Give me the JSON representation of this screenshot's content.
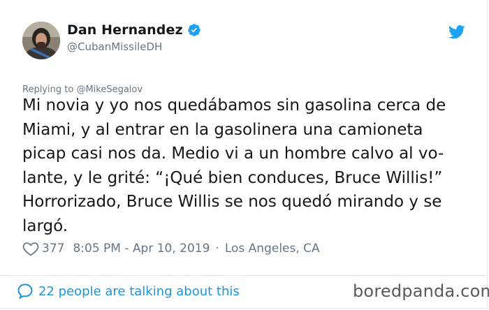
{
  "author": {
    "name": "Dan Hernandez",
    "handle": "@CubanMissileDH",
    "verified": true
  },
  "reply": {
    "prefix": "Replying to ",
    "to": "@MikeSegalov"
  },
  "tweet": {
    "lines": [
      "Mi novia y yo nos quedábamos sin gasolina cerca de",
      "Miami, y al entrar en la gasolinera una camioneta",
      "picap casi nos da. Medio vi a un hombre calvo al vo-",
      "lante, y le grité: “¡Qué bien conduces, Bruce Willis!”",
      "Horrorizado, Bruce Willis se nos quedó mirando y se",
      "largó."
    ]
  },
  "meta": {
    "likes": "377",
    "time": "8:05 PM - Apr 10, 2019",
    "separator": "·",
    "location": "Los Angeles, CA"
  },
  "footer": {
    "talking": "22 people are talking about this"
  },
  "watermark": "boredpanda.com",
  "icons": {
    "verified": "verified-badge-icon",
    "bird": "twitter-bird-icon",
    "like": "heart-icon",
    "conversation": "speech-bubble-icon"
  },
  "colors": {
    "accent": "#1da1f2",
    "link": "#1b95e0",
    "muted": "#657786",
    "text": "#14171a"
  }
}
